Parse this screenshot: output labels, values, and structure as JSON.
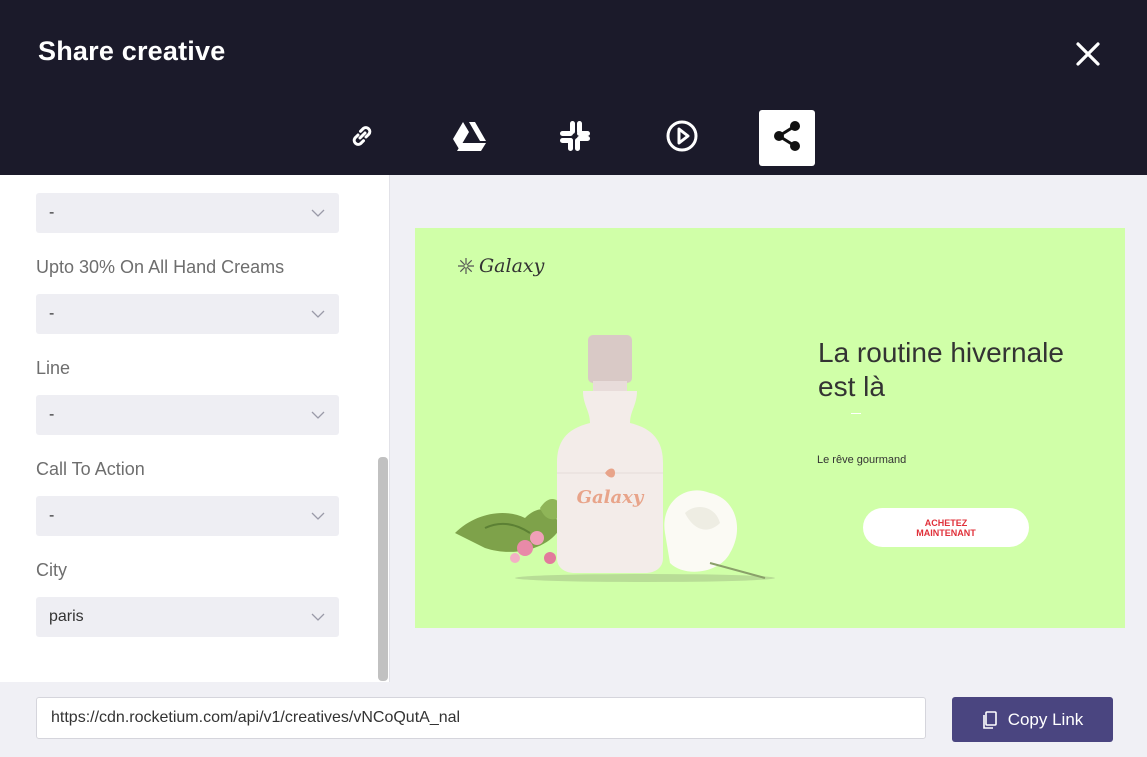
{
  "dialog": {
    "title": "Share creative"
  },
  "tabs": [
    {
      "name": "link-icon",
      "active": false
    },
    {
      "name": "google-drive-icon",
      "active": false
    },
    {
      "name": "slack-icon",
      "active": false
    },
    {
      "name": "play-icon",
      "active": false
    },
    {
      "name": "share-icon",
      "active": true
    }
  ],
  "fields": [
    {
      "label": "",
      "value": "-"
    },
    {
      "label": "Upto 30% On All Hand Creams",
      "value": "-"
    },
    {
      "label": "Line",
      "value": "-"
    },
    {
      "label": "Call To Action",
      "value": "-"
    },
    {
      "label": "City",
      "value": "paris"
    }
  ],
  "creative": {
    "brand": "Galaxy",
    "headline_line1": "La routine hivernale",
    "headline_line2": "est là",
    "subline": "Le rêve gourmand",
    "cta": "ACHETEZ\nMAINTENANT",
    "product_label": "Galaxy",
    "background_color": "#d0ffa8"
  },
  "footer": {
    "url": "https://cdn.rocketium.com/api/v1/creatives/vNCoQutA_nal",
    "copy_label": "Copy Link"
  },
  "colors": {
    "header": "#1b1a2a",
    "accent": "#4a4580",
    "cta_text": "#e0303a"
  }
}
